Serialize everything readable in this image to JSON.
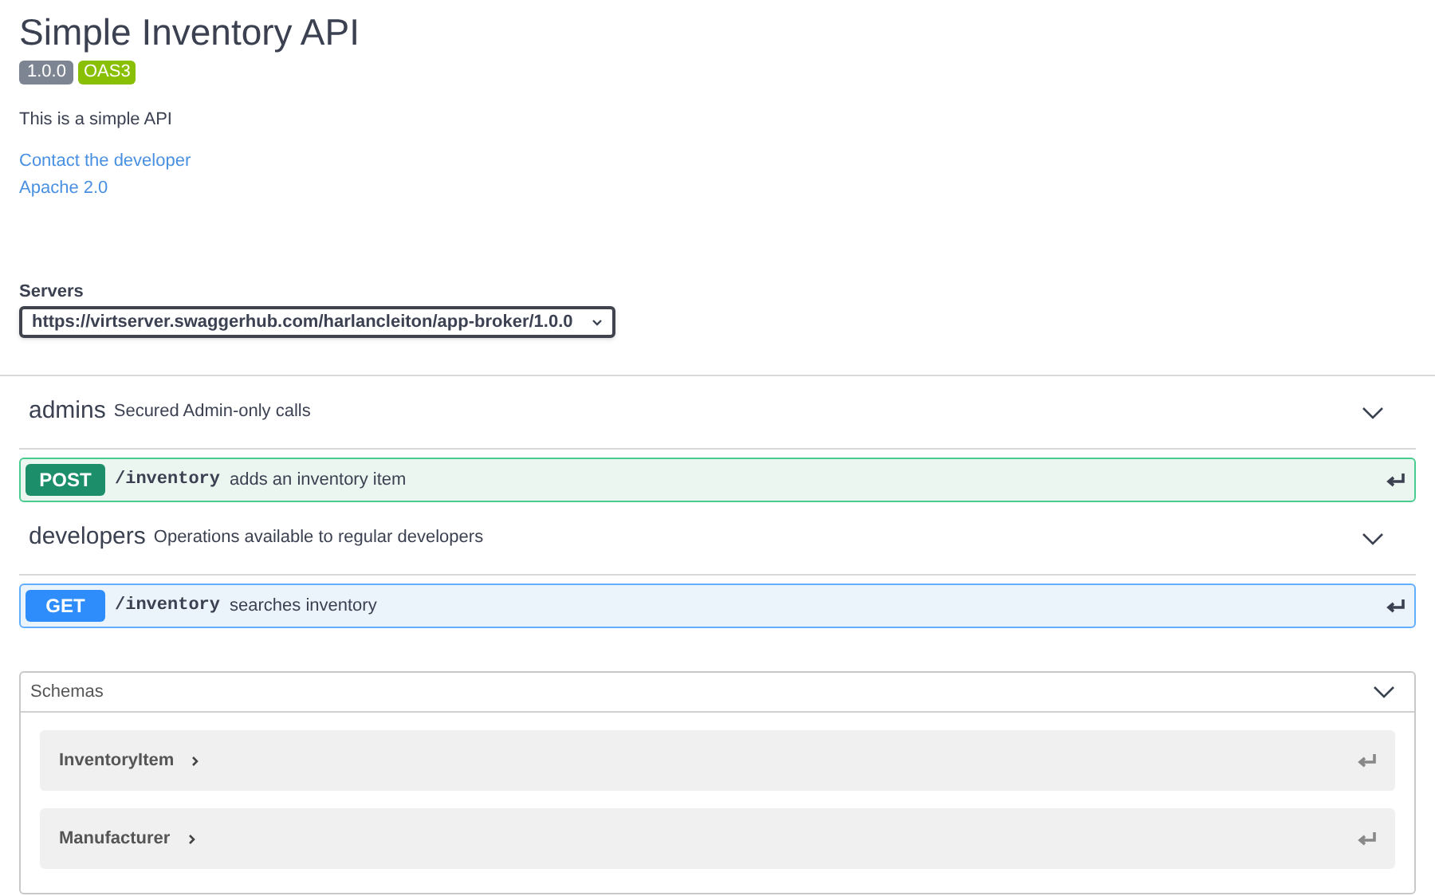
{
  "info": {
    "title": "Simple Inventory API",
    "version": "1.0.0",
    "spec_badge": "OAS3",
    "description": "This is a simple API",
    "links": [
      "Contact the developer",
      "Apache 2.0"
    ]
  },
  "servers": {
    "label": "Servers",
    "value": "https://virtserver.swaggerhub.com/harlancleiton/app-broker/1.0.0"
  },
  "tags": [
    {
      "name": "admins",
      "description": "Secured Admin-only calls",
      "operations": [
        {
          "method": "POST",
          "path": "/inventory",
          "summary": "adds an inventory item"
        }
      ]
    },
    {
      "name": "developers",
      "description": "Operations available to regular developers",
      "operations": [
        {
          "method": "GET",
          "path": "/inventory",
          "summary": "searches inventory"
        }
      ]
    }
  ],
  "schemas": {
    "title": "Schemas",
    "items": [
      "InventoryItem",
      "Manufacturer"
    ]
  }
}
